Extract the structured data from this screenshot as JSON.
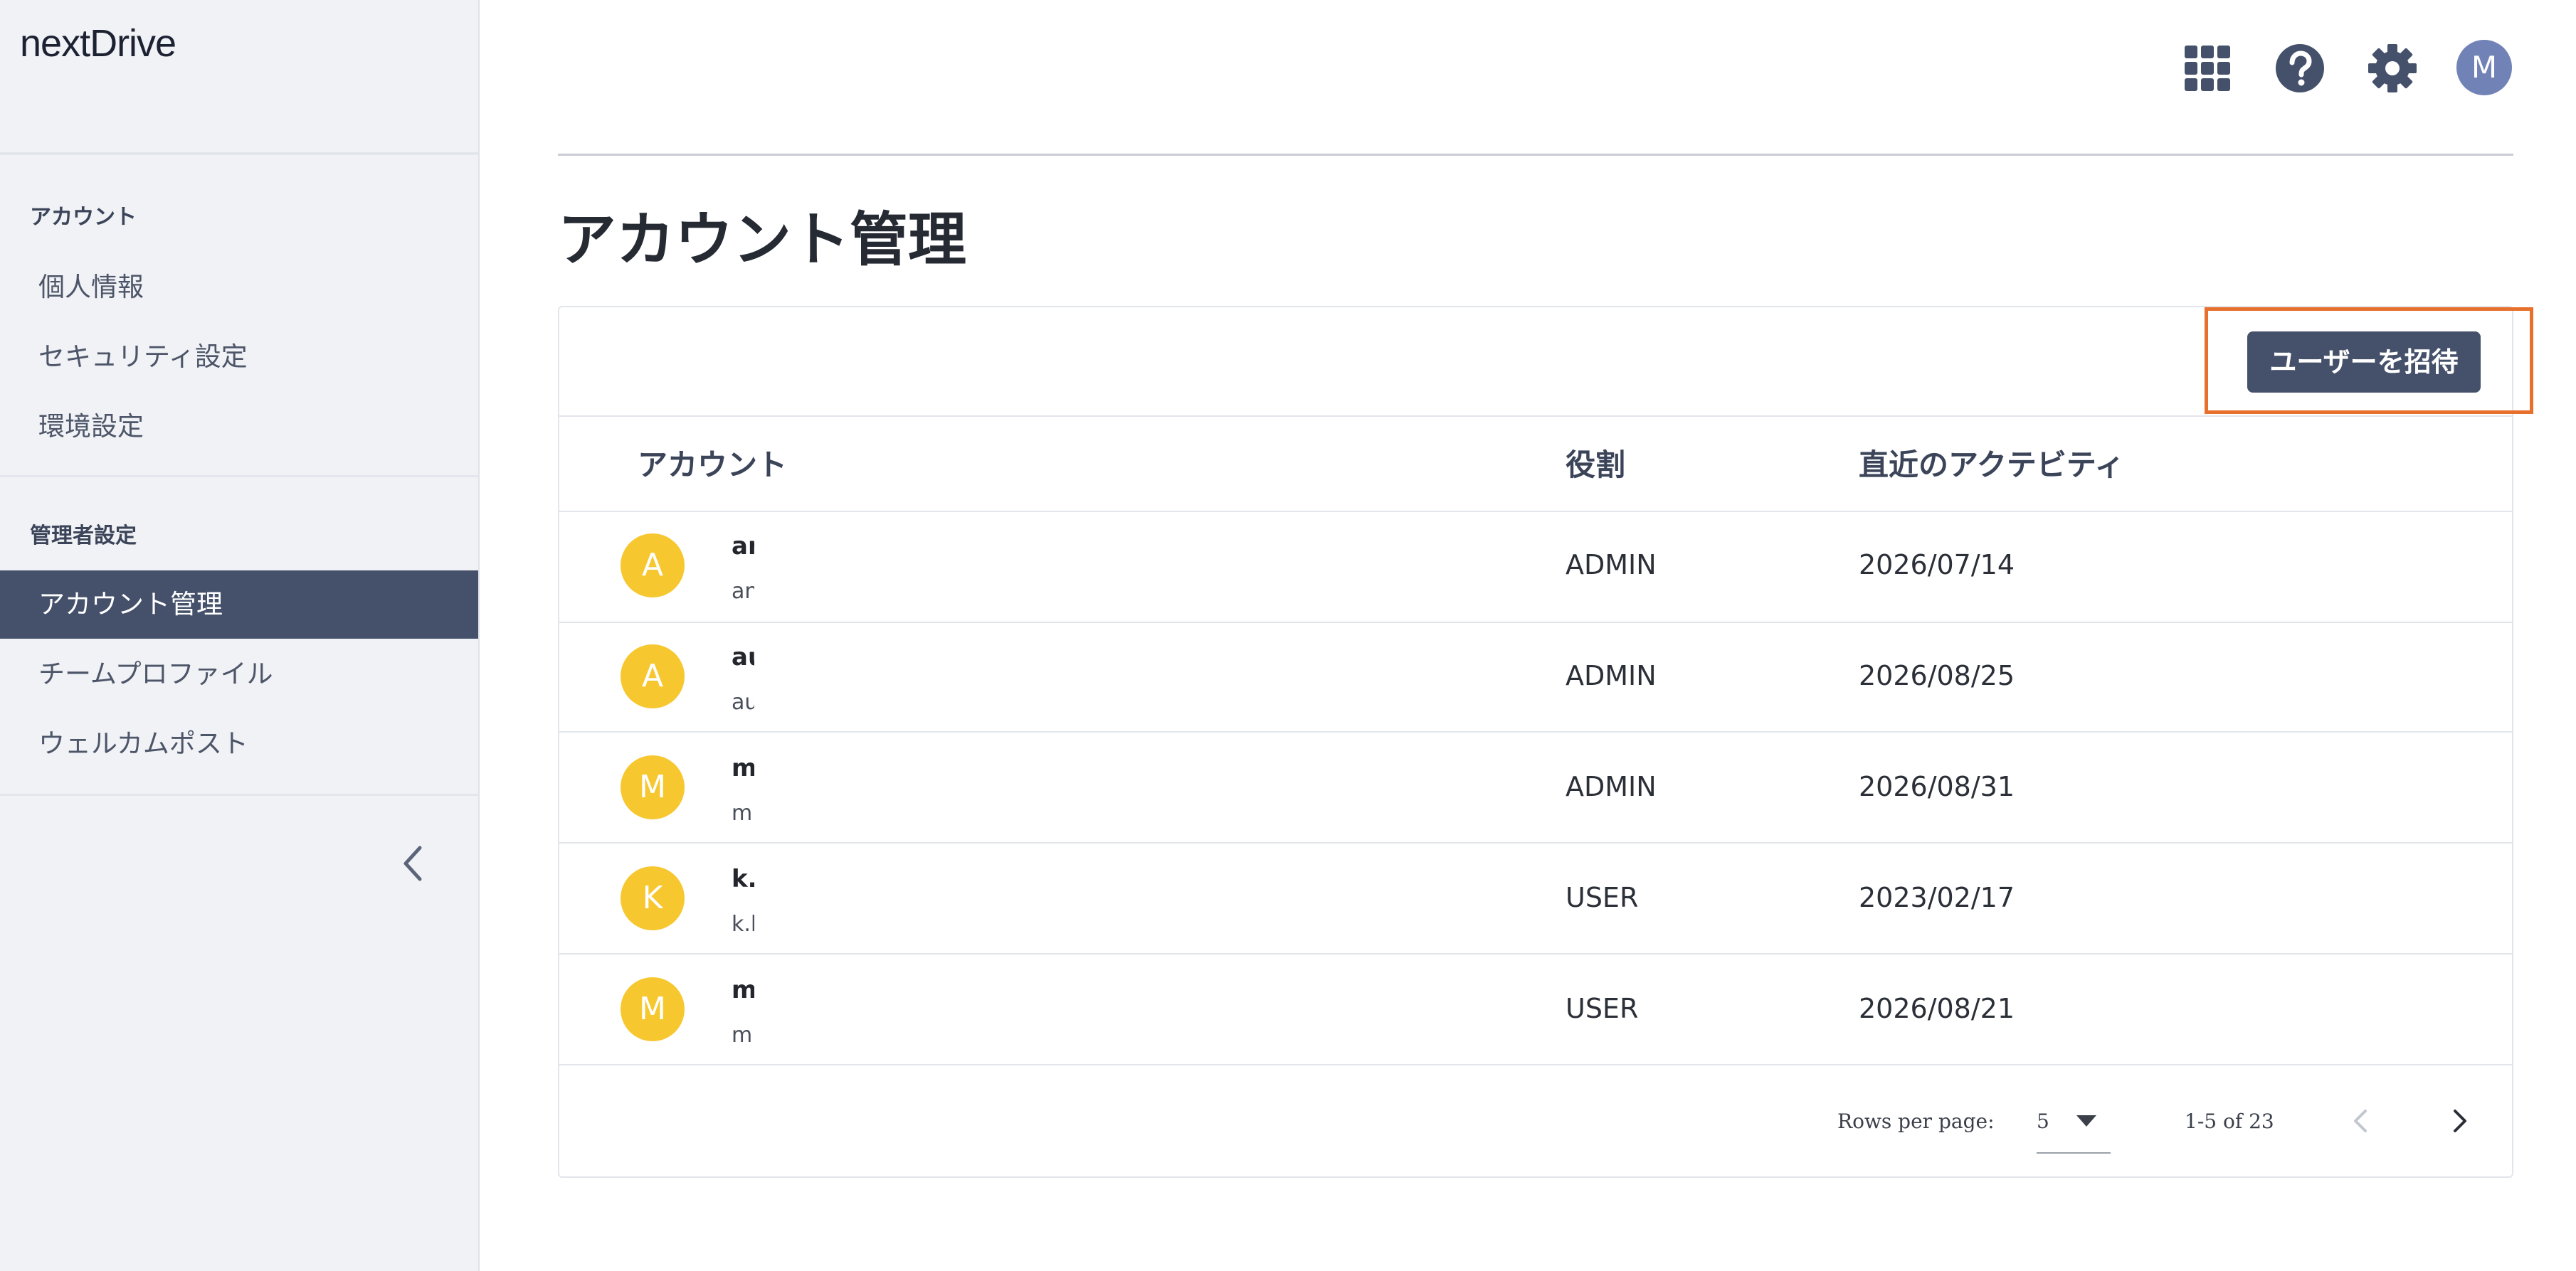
{
  "app": {
    "logo_text": "nextDrive"
  },
  "sidebar": {
    "sections": [
      {
        "heading": "アカウント",
        "items": [
          "個人情報",
          "セキュリティ設定",
          "環境設定"
        ]
      },
      {
        "heading": "管理者設定",
        "items": [
          "アカウント管理",
          "チームプロファイル",
          "ウェルカムポスト"
        ]
      }
    ],
    "active_item": "アカウント管理"
  },
  "topbar": {
    "user_initial": "M",
    "icons": [
      "apps-grid-icon",
      "help-icon",
      "settings-gear-icon"
    ]
  },
  "page": {
    "title": "アカウント管理"
  },
  "toolbar": {
    "invite_label": "ユーザーを招待"
  },
  "table": {
    "columns": [
      "アカウント",
      "役割",
      "直近のアクテビティ"
    ],
    "rows": [
      {
        "initial": "A",
        "name": "ar",
        "email": "an",
        "role": "ADMIN",
        "last_activity": "2026/07/14"
      },
      {
        "initial": "A",
        "name": "au",
        "email": "au",
        "role": "ADMIN",
        "last_activity": "2026/08/25"
      },
      {
        "initial": "M",
        "name": "m",
        "email": "mi",
        "role": "ADMIN",
        "last_activity": "2026/08/31"
      },
      {
        "initial": "K",
        "name": "k.",
        "email": "k.l",
        "role": "USER",
        "last_activity": "2023/02/17"
      },
      {
        "initial": "M",
        "name": "m",
        "email": "m.",
        "role": "USER",
        "last_activity": "2026/08/21"
      }
    ]
  },
  "pagination": {
    "rows_per_page_label": "Rows per page:",
    "rows_per_page": "5",
    "range_text": "1-5 of 23"
  },
  "colors": {
    "accent": "#45506b",
    "avatar": "#f7c730",
    "highlight": "#e8702d",
    "sidebar_bg": "#f0f2f6"
  }
}
